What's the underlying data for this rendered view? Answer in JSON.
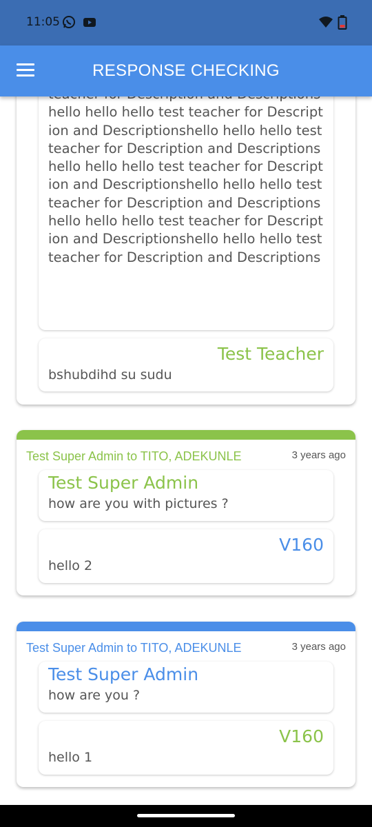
{
  "status_bar": {
    "time": "11:05",
    "icons": [
      "whatsapp-icon",
      "youtube-icon",
      "wifi-icon",
      "battery-icon"
    ]
  },
  "app_bar": {
    "title": "RESPONSE CHECKING",
    "menu_icon": "hamburger-menu-icon"
  },
  "colors": {
    "app_bar": "#4a8ee8",
    "status_bar": "#3b6db3",
    "green": "#8bc34a",
    "blue": "#4a8ee8"
  },
  "cards": [
    {
      "question_text": "teacher for Description and Descriptionshello hello hello test teacher for Description and Descriptionshello hello hello test teacher for Description and Descriptionshello hello hello test teacher for Description and Descriptionshello hello hello test teacher for Description and Descriptionshello hello hello test teacher for Description and Descriptionshello hello hello test teacher for Description and Descriptions",
      "reply_name": "Test Teacher",
      "reply_text": "bshubdihd su sudu"
    },
    {
      "header": "Test Super Admin to TITO, ADEKUNLE",
      "time_ago": "3 years ago",
      "question_name": "Test Super Admin",
      "question_text": "how are you with pictures ?",
      "reply_name": "V160",
      "reply_text": "hello 2"
    },
    {
      "header": "Test Super Admin to TITO, ADEKUNLE",
      "time_ago": "3 years ago",
      "question_name": "Test Super Admin",
      "question_text": "how are you ?",
      "reply_name": "V160",
      "reply_text": "hello 1"
    }
  ]
}
